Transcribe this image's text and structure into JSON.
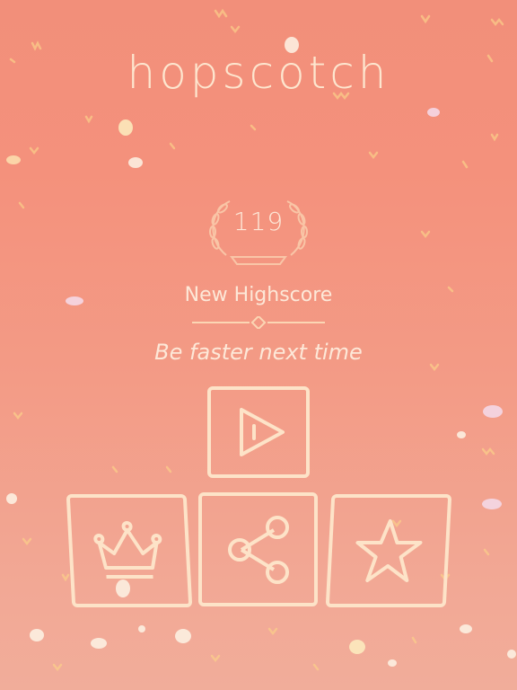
{
  "game": {
    "title": "hopscotch",
    "score": "119",
    "highscore_label": "New Highscore",
    "message": "Be faster next time"
  },
  "buttons": {
    "play": "play-icon",
    "leaderboard": "crown-icon",
    "share": "share-icon",
    "rate": "star-icon"
  },
  "colors": {
    "background_top": "#f28f7a",
    "background_bottom": "#f1ad9a",
    "outline": "#fde3c8",
    "text": "#fde8d8"
  }
}
